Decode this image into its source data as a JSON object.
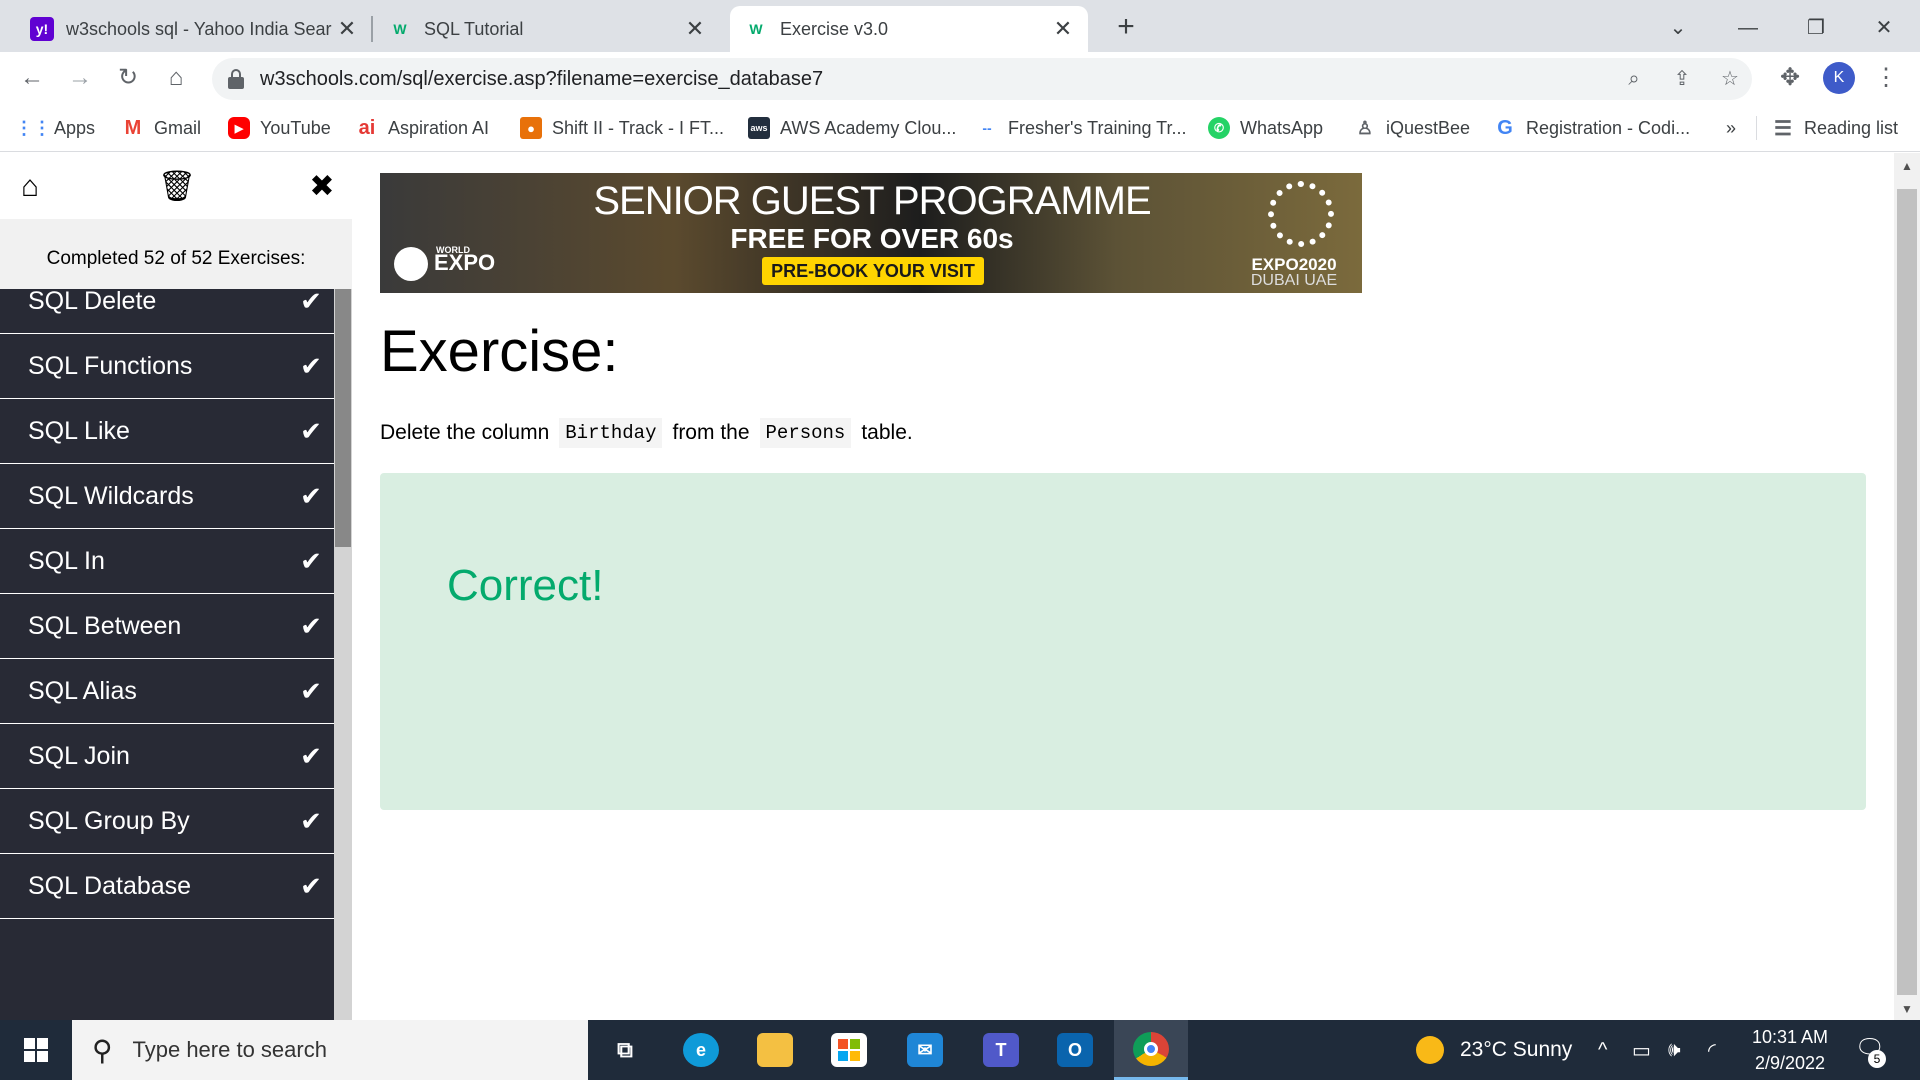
{
  "browser": {
    "tabs": [
      {
        "title": "w3schools sql - Yahoo India Sear",
        "favicon": "y!",
        "active": false
      },
      {
        "title": "SQL Tutorial",
        "favicon": "W",
        "active": false
      },
      {
        "title": "Exercise v3.0",
        "favicon": "W",
        "active": true
      }
    ],
    "url": "w3schools.com/sql/exercise.asp?filename=exercise_database7",
    "avatar_letter": "K",
    "bookmarks": [
      {
        "label": "Apps",
        "icon": "apps-grid-icon"
      },
      {
        "label": "Gmail",
        "icon": "gmail-icon"
      },
      {
        "label": "YouTube",
        "icon": "youtube-icon"
      },
      {
        "label": "Aspiration AI",
        "icon": "aspiration-ai-icon"
      },
      {
        "label": "Shift II - Track - I FT...",
        "icon": "shift-icon"
      },
      {
        "label": "AWS Academy Clou...",
        "icon": "aws-icon"
      },
      {
        "label": "Fresher's Training Tr...",
        "icon": "training-icon"
      },
      {
        "label": "WhatsApp",
        "icon": "whatsapp-icon"
      },
      {
        "label": "iQuestBee",
        "icon": "iquestbee-icon"
      },
      {
        "label": "Registration - Codi...",
        "icon": "google-icon"
      }
    ],
    "more_bookmarks": "»",
    "reading_list": "Reading list"
  },
  "sidebar": {
    "status": "Completed 52 of 52 Exercises:",
    "items": [
      {
        "label": "SQL Delete",
        "done": true
      },
      {
        "label": "SQL Functions",
        "done": true
      },
      {
        "label": "SQL Like",
        "done": true
      },
      {
        "label": "SQL Wildcards",
        "done": true
      },
      {
        "label": "SQL In",
        "done": true
      },
      {
        "label": "SQL Between",
        "done": true
      },
      {
        "label": "SQL Alias",
        "done": true
      },
      {
        "label": "SQL Join",
        "done": true
      },
      {
        "label": "SQL Group By",
        "done": true
      },
      {
        "label": "SQL Database",
        "done": true
      }
    ],
    "check_glyph": "✔"
  },
  "banner": {
    "headline": "SENIOR GUEST PROGRAMME",
    "subline": "FREE FOR OVER 60s",
    "cta": "PRE-BOOK YOUR VISIT",
    "logo_left_small": "WORLD",
    "logo_left": "EXPO",
    "logo_right": "EXPO2020",
    "logo_right_sub": "DUBAI UAE"
  },
  "exercise": {
    "heading": "Exercise:",
    "desc_part1": "Delete the column",
    "code1": "Birthday",
    "desc_part2": "from the",
    "code2": "Persons",
    "desc_part3": "table.",
    "result": "Correct!",
    "result_color": "#04aa6d",
    "result_bg": "#d9eee1"
  },
  "taskbar": {
    "search_placeholder": "Type here to search",
    "weather": "23°C  Sunny",
    "time": "10:31 AM",
    "date": "2/9/2022",
    "notifications": "5"
  }
}
